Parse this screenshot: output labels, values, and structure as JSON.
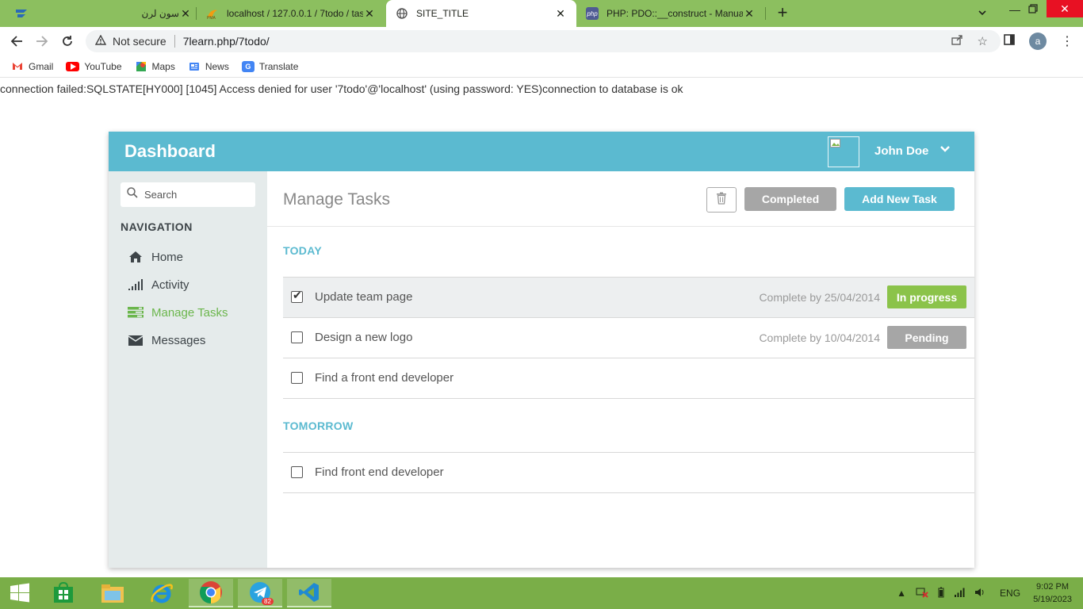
{
  "browser": {
    "tabs": [
      {
        "title": "سون لرن",
        "active": false
      },
      {
        "title": "localhost / 127.0.0.1 / 7todo / tas",
        "active": false
      },
      {
        "title": "SITE_TITLE",
        "active": true
      },
      {
        "title": "PHP: PDO::__construct - Manual",
        "active": false
      }
    ],
    "security_label": "Not secure",
    "url": "7learn.php/7todo/",
    "profile_initial": "a",
    "bookmarks": [
      "Gmail",
      "YouTube",
      "Maps",
      "News",
      "Translate"
    ]
  },
  "page": {
    "error_message": "connection failed:SQLSTATE[HY000] [1045] Access denied for user '7todo'@'localhost' (using password: YES)connection to database is ok"
  },
  "app": {
    "brand": "Dashboard",
    "user_name": "John Doe",
    "search_placeholder": "Search",
    "nav_title": "NAVIGATION",
    "nav_items": [
      {
        "label": "Home",
        "icon": "home-icon",
        "active": false
      },
      {
        "label": "Activity",
        "icon": "signal-icon",
        "active": false
      },
      {
        "label": "Manage Tasks",
        "icon": "tasks-icon",
        "active": true
      },
      {
        "label": "Messages",
        "icon": "envelope-icon",
        "active": false
      }
    ],
    "main_title": "Manage Tasks",
    "buttons": {
      "completed": "Completed",
      "add_new": "Add New Task"
    },
    "sections": [
      {
        "title": "TODAY",
        "tasks": [
          {
            "name": "Update team page",
            "checked": true,
            "due": "Complete by 25/04/2014",
            "status": "In progress",
            "status_color": "#8bc34a"
          },
          {
            "name": "Design a new logo",
            "checked": false,
            "due": "Complete by 10/04/2014",
            "status": "Pending",
            "status_color": "#a6a6a6"
          },
          {
            "name": "Find a front end developer",
            "checked": false,
            "due": "",
            "status": "",
            "status_color": ""
          }
        ]
      },
      {
        "title": "TOMORROW",
        "tasks": [
          {
            "name": "Find front end developer",
            "checked": false,
            "due": "",
            "status": "",
            "status_color": ""
          }
        ]
      }
    ],
    "colors": {
      "accent": "#5bbad0",
      "active_nav": "#6bb64c",
      "sidebar_bg": "#e5ebeb"
    }
  },
  "taskbar": {
    "telegram_badge": "82",
    "language": "ENG",
    "time": "9:02 PM",
    "date": "5/19/2023"
  }
}
